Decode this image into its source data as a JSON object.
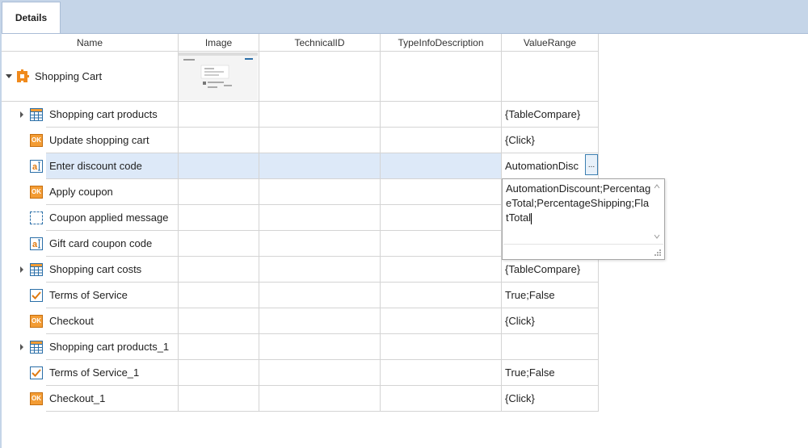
{
  "tabs": [
    {
      "label": "Details",
      "active": true
    }
  ],
  "columns": [
    "Name",
    "Image",
    "TechnicalID",
    "TypeInfoDescription",
    "ValueRange"
  ],
  "root": {
    "name": "Shopping Cart",
    "icon": "puzzle-icon",
    "expanded": true,
    "has_image": true
  },
  "rows": [
    {
      "name": "Shopping cart products",
      "icon": "table-icon",
      "expandable": true,
      "value_range": "{TableCompare}"
    },
    {
      "name": "Update shopping cart",
      "icon": "ok-button-icon",
      "expandable": false,
      "value_range": "{Click}"
    },
    {
      "name": "Enter discount code",
      "icon": "textbox-icon",
      "expandable": false,
      "value_range": "AutomationDisc",
      "selected": true
    },
    {
      "name": "Apply coupon",
      "icon": "ok-button-icon",
      "expandable": false,
      "value_range": ""
    },
    {
      "name": "Coupon applied message",
      "icon": "dashed-box-icon",
      "expandable": false,
      "value_range": ""
    },
    {
      "name": "Gift card coupon code",
      "icon": "textbox-icon",
      "expandable": false,
      "value_range": ""
    },
    {
      "name": "Shopping cart costs",
      "icon": "table-icon",
      "expandable": true,
      "value_range": "{TableCompare}"
    },
    {
      "name": "Terms of Service",
      "icon": "checkbox-icon",
      "expandable": false,
      "value_range": "True;False"
    },
    {
      "name": "Checkout",
      "icon": "ok-button-icon",
      "expandable": false,
      "value_range": "{Click}"
    },
    {
      "name": "Shopping cart products_1",
      "icon": "table-icon",
      "expandable": true,
      "value_range": ""
    },
    {
      "name": "Terms of Service_1",
      "icon": "checkbox-icon",
      "expandable": false,
      "value_range": "True;False"
    },
    {
      "name": "Checkout_1",
      "icon": "ok-button-icon",
      "expandable": false,
      "value_range": "{Click}"
    }
  ],
  "editor": {
    "button_label": "...",
    "dropdown_text": "AutomationDiscount;PercentageTotal;PercentageShipping;FlatTotal"
  },
  "colors": {
    "tabbar": "#c5d5e8",
    "selection": "#dde9f8",
    "icon_orange": "#f39c34",
    "icon_blue": "#2b6fa8"
  }
}
